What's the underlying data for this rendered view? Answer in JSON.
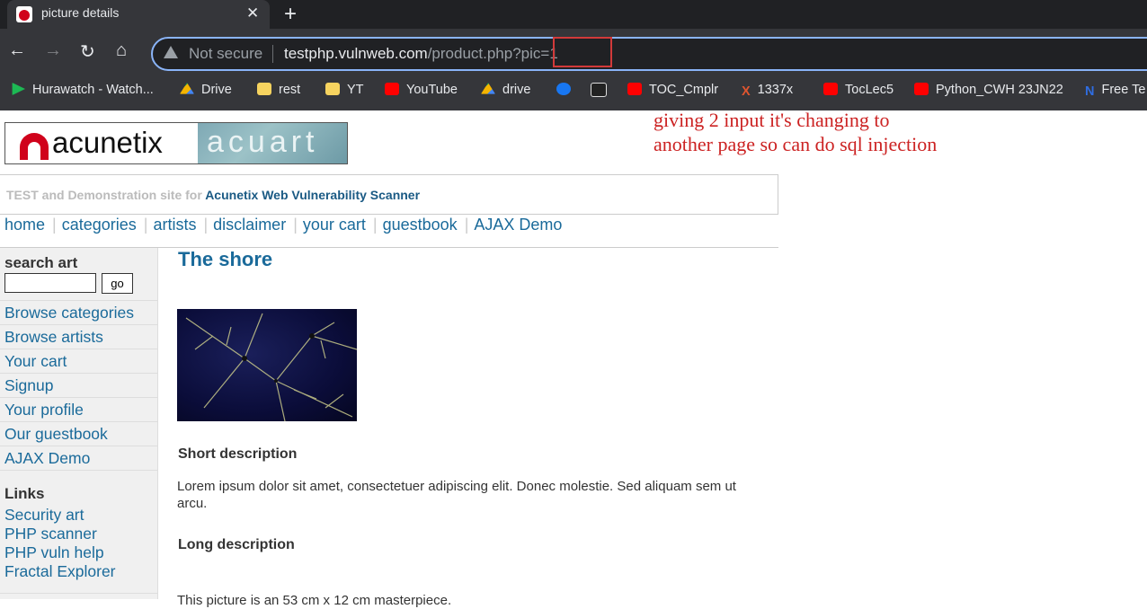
{
  "browser": {
    "tab_title": "picture details",
    "not_secure": "Not secure",
    "url_host": "testphp.vulnweb.com",
    "url_path": "/product.php?pic=1",
    "bookmarks": [
      {
        "label": "Hurawatch - Watch...",
        "icon": "play-icon"
      },
      {
        "label": "Drive",
        "icon": "drive-icon"
      },
      {
        "label": "rest",
        "icon": "folder-icon"
      },
      {
        "label": "YT",
        "icon": "folder-icon"
      },
      {
        "label": "YouTube",
        "icon": "youtube-icon"
      },
      {
        "label": "drive",
        "icon": "drive-icon"
      },
      {
        "label": "",
        "icon": "facebook-icon"
      },
      {
        "label": "",
        "icon": "100plus-icon"
      },
      {
        "label": "TOC_Cmplr",
        "icon": "youtube-icon"
      },
      {
        "label": "1337x",
        "icon": "x-icon"
      },
      {
        "label": "TocLec5",
        "icon": "youtube-icon"
      },
      {
        "label": "Python_CWH 23JN22",
        "icon": "youtube-icon"
      },
      {
        "label": "Free Te",
        "icon": "n-icon"
      }
    ]
  },
  "annotation": {
    "line1": "giving 2 input it's changing to",
    "line2": "another page so can do sql injection"
  },
  "site": {
    "logo_left": "acunetix",
    "logo_right": "acuart",
    "tagline_prefix": "TEST and Demonstration site for",
    "tagline_brand": "Acunetix Web Vulnerability Scanner",
    "nav": [
      "home",
      "categories",
      "artists",
      "disclaimer",
      "your cart",
      "guestbook",
      "AJAX Demo"
    ],
    "search_title": "search art",
    "search_button": "go",
    "sidebar": [
      "Browse categories",
      "Browse artists",
      "Your cart",
      "Signup",
      "Your profile",
      "Our guestbook",
      "AJAX Demo"
    ],
    "links_title": "Links",
    "links": [
      "Security art",
      "PHP scanner",
      "PHP vuln help",
      "Fractal Explorer"
    ]
  },
  "product": {
    "title": "The shore",
    "short_heading": "Short description",
    "short_text": "Lorem ipsum dolor sit amet, consectetuer adipiscing elit. Donec molestie. Sed aliquam sem ut arcu.",
    "long_heading": "Long description",
    "long_text": "This picture is an 53 cm x 12 cm masterpiece."
  }
}
